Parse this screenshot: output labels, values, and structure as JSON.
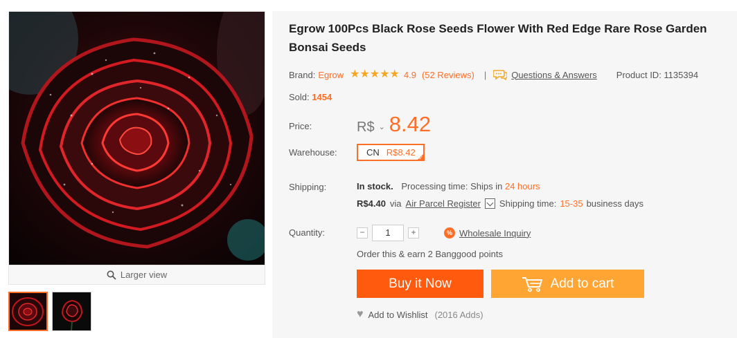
{
  "gallery": {
    "larger_view_label": "Larger view"
  },
  "product": {
    "title": "Egrow 100Pcs Black Rose Seeds Flower With Red Edge Rare Rose Garden Bonsai Seeds",
    "brand_label": "Brand:",
    "brand": "Egrow",
    "rating": "4.9",
    "rating_stars": 4.9,
    "reviews": "(52 Reviews)",
    "separator": "|",
    "qa_label": "Questions & Answers",
    "product_id": "Product ID: 1135394",
    "sold_label": "Sold:",
    "sold_value": "1454"
  },
  "price": {
    "label": "Price:",
    "currency": "R$",
    "caret": "⌄",
    "value": "8.42"
  },
  "warehouse": {
    "label": "Warehouse:",
    "code": "CN",
    "price": "R$8.42"
  },
  "shipping": {
    "label": "Shipping:",
    "stock": "In stock.",
    "processing_label": "Processing time:",
    "ships_in": "Ships in",
    "processing_value": "24 hours",
    "cost": "R$4.40",
    "via": "via",
    "method": "Air Parcel Register",
    "ship_time_label": "Shipping time:",
    "ship_time_value": "15-35",
    "ship_time_unit": "business days"
  },
  "quantity": {
    "label": "Quantity:",
    "minus": "−",
    "value": "1",
    "plus": "+",
    "wholesale_icon": "%",
    "wholesale_label": "Wholesale Inquiry"
  },
  "points_text": "Order this & earn 2 Banggood points",
  "buttons": {
    "buy_now": "Buy it Now",
    "add_to_cart": "Add to cart"
  },
  "wishlist": {
    "label": "Add to Wishlist",
    "adds": "(2016 Adds)"
  },
  "colors": {
    "accent": "#ff6e26",
    "buy": "#ff5a0d",
    "cart": "#ffa533"
  }
}
